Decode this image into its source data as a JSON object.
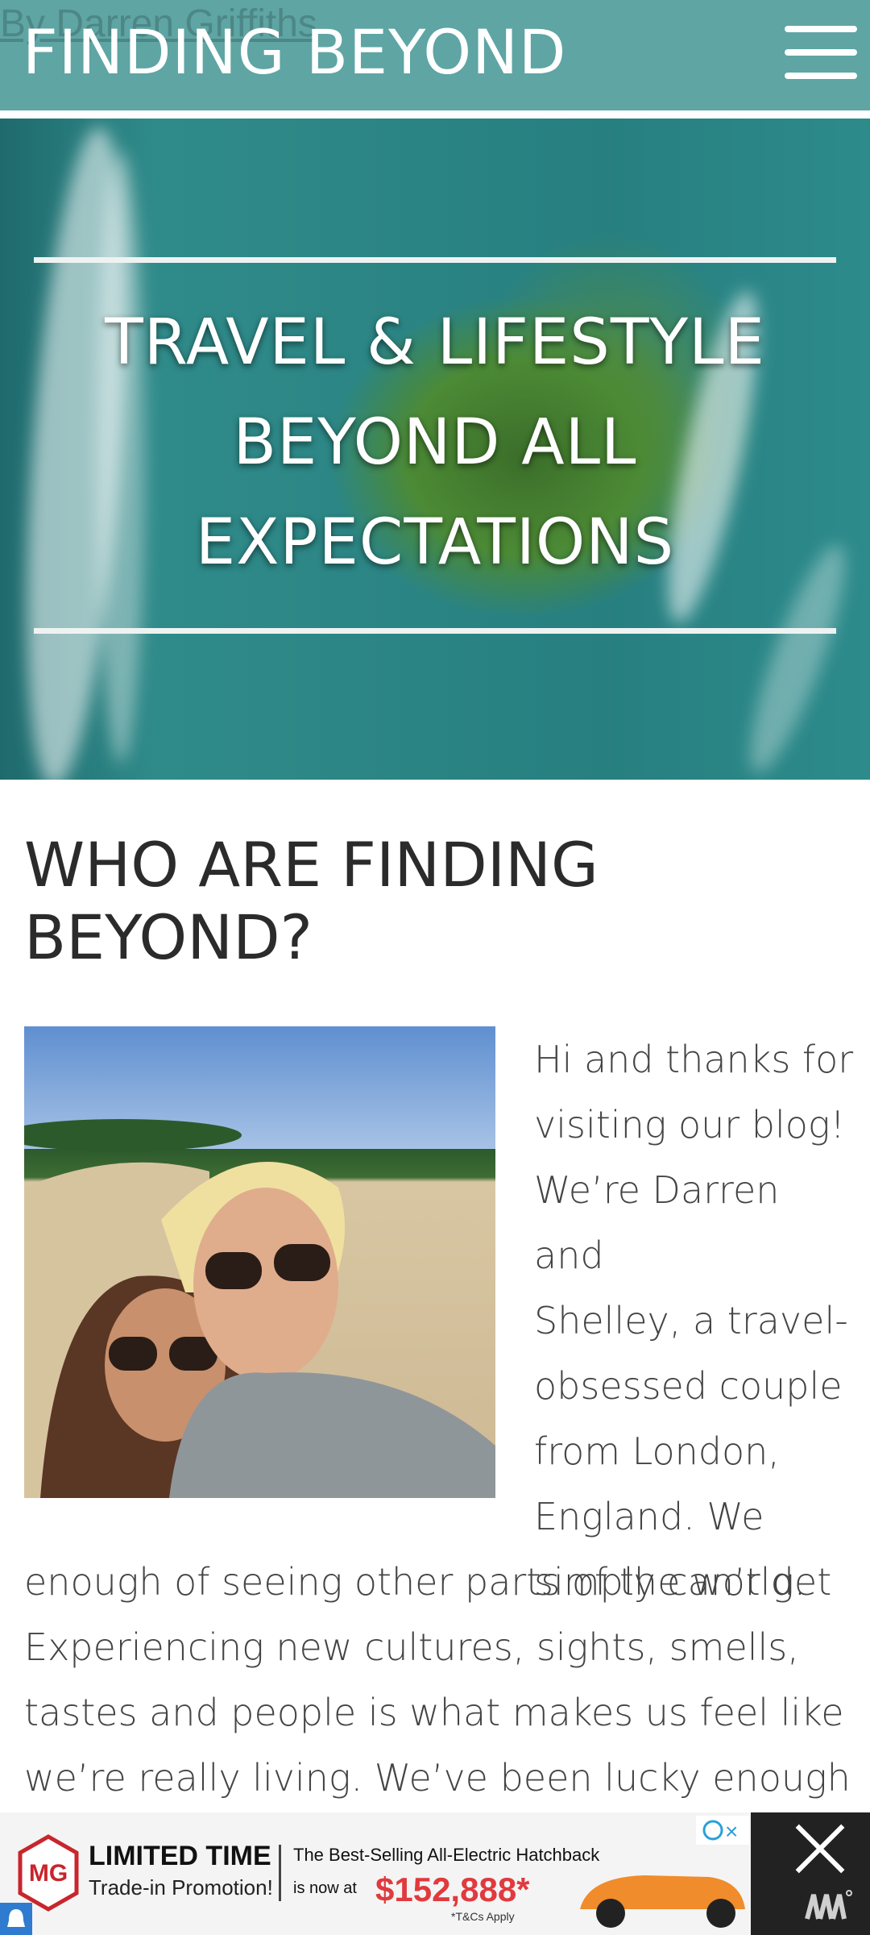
{
  "header": {
    "byline": "By Darren Griffiths",
    "brand": "FINDING BEYOND",
    "menu_icon": "hamburger-menu-icon"
  },
  "hero": {
    "title_lines": [
      "TRAVEL & LIFESTYLE",
      "BEYOND ALL",
      "EXPECTATIONS"
    ]
  },
  "section": {
    "title_lines": [
      "WHO ARE FINDING",
      "BEYOND?"
    ]
  },
  "intro": {
    "wrap_lines": [
      "Hi and thanks for",
      "visiting our blog!",
      "We’re Darren and",
      "Shelley, a travel-",
      "obsessed couple",
      "from London,",
      "England. We",
      "simply can’t get"
    ],
    "full_lines": [
      "enough of seeing other parts of the world.",
      "Experiencing new cultures, sights, smells,",
      "tastes and people is what makes us feel like",
      "we’re really living. We’ve been lucky enough to"
    ]
  },
  "ad": {
    "brand_logo": "MG",
    "headline": "LIMITED TIME",
    "subline": "Trade-in Promotion!",
    "copy_line1": "The Best-Selling All-Electric Hatchback",
    "copy_line2_prefix": "is now at",
    "price": "$152,888*",
    "fineprint": "*T&Cs Apply",
    "adchoices_icon": "adchoices-icon",
    "close_icon": "close-icon",
    "bell_icon": "bell-icon",
    "publisher_icon": "publisher-logo-icon"
  },
  "colors": {
    "header_bg": "#5ea5a4",
    "ad_price": "#e03a3e"
  }
}
